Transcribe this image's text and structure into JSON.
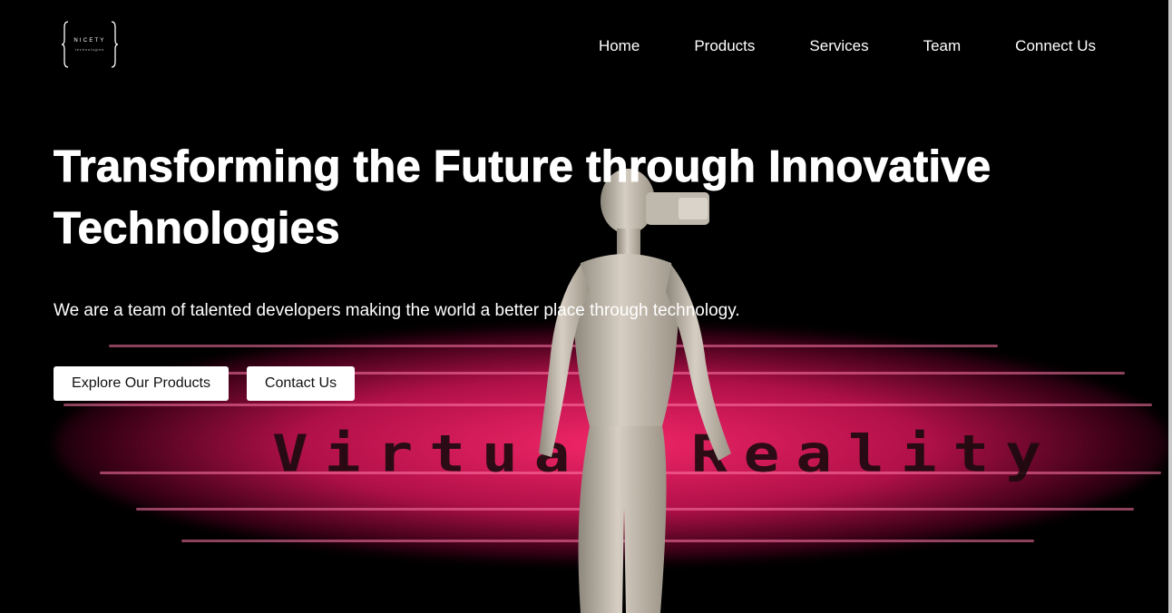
{
  "brand": {
    "logo_name": "NICETY",
    "logo_sub": "technologies"
  },
  "nav": {
    "items": [
      {
        "label": "Home"
      },
      {
        "label": "Products"
      },
      {
        "label": "Services"
      },
      {
        "label": "Team"
      },
      {
        "label": "Connect Us"
      }
    ]
  },
  "hero": {
    "headline": "Transforming the Future through Innovative Technologies",
    "subtitle": "We are a team of talented developers making the world a better place through technology.",
    "primary_button": "Explore Our Products",
    "secondary_button": "Contact Us",
    "background_text": "Virtual Reality"
  },
  "colors": {
    "background": "#000000",
    "glow": "#e8145c",
    "text": "#ffffff",
    "button_bg": "#ffffff",
    "button_text": "#111111"
  }
}
